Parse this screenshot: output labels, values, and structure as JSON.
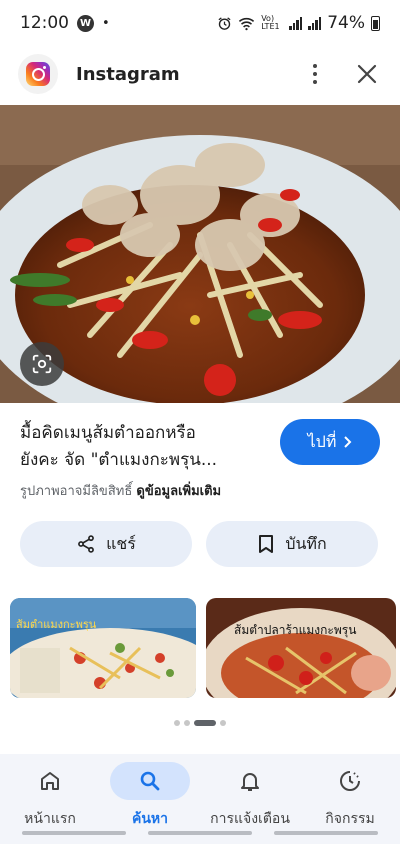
{
  "status_bar": {
    "time": "12:00",
    "w_badge": "W",
    "dot": "•",
    "network": "Vo) LTE1",
    "battery": "74%"
  },
  "header": {
    "app_title": "Instagram",
    "logo_icon": "instagram-icon",
    "more_icon": "more-vert-icon",
    "close_icon": "close-icon"
  },
  "result": {
    "title_line1": "มื้อคิดเมนูส้มตำออกหรือ",
    "title_line2": "ยังคะ จัด \"ตำแมงกะพรุน...",
    "disclaimer": "รูปภาพอาจมีลิขสิทธิ์",
    "more_info": "ดูข้อมูลเพิ่มเติม",
    "visit_label": "ไปที่",
    "visit_icon": "chevron-right-icon"
  },
  "actions": {
    "share_label": "แชร์",
    "share_icon": "share-icon",
    "save_label": "บันทึก",
    "save_icon": "bookmark-icon"
  },
  "related": [
    {
      "caption": "ส้มตำแมงกะพรุน"
    },
    {
      "caption": "ส้มตำปลาร้าแมงกะพรุน"
    }
  ],
  "bottom_nav": [
    {
      "label": "หน้าแรก",
      "icon": "home-icon",
      "active": false
    },
    {
      "label": "ค้นหา",
      "icon": "search-icon",
      "active": true
    },
    {
      "label": "การแจ้งเตือน",
      "icon": "bell-icon",
      "active": false
    },
    {
      "label": "กิจกรรม",
      "icon": "activity-icon",
      "active": false
    }
  ],
  "colors": {
    "accent": "#1a73e8",
    "action_bg": "#e8eef8",
    "nav_bg": "#f3f5fa",
    "nav_active_bg": "#d3e3fd"
  }
}
